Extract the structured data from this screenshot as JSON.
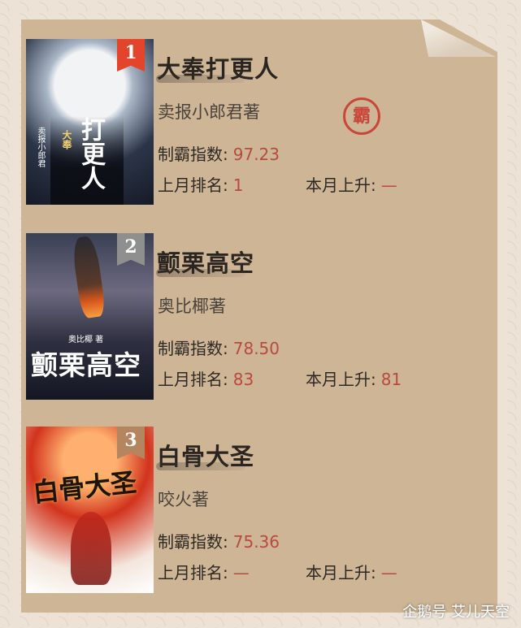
{
  "books": [
    {
      "rank": "1",
      "rank_color": "#e2442c",
      "title": "大奉打更人",
      "author": "卖报小郎君著",
      "index_label": "制霸指数:",
      "index_value": "97.23",
      "last_label": "上月排名:",
      "last_value": "1",
      "rise_label": "本月上升:",
      "rise_value": "—",
      "cover_title": "打更人",
      "cover_sub": "大奉",
      "cover_author": "卖报小郎君",
      "seal": "霸"
    },
    {
      "rank": "2",
      "rank_color": "#8f8f8f",
      "title": "颤栗高空",
      "author": "奥比椰著",
      "index_label": "制霸指数:",
      "index_value": "78.50",
      "last_label": "上月排名:",
      "last_value": "83",
      "rise_label": "本月上升:",
      "rise_value": "81",
      "cover_title": "颤栗高空",
      "cover_author": "奥比椰 著"
    },
    {
      "rank": "3",
      "rank_color": "#b58560",
      "title": "白骨大圣",
      "author": "咬火著",
      "index_label": "制霸指数:",
      "index_value": "75.36",
      "last_label": "上月排名:",
      "last_value": "—",
      "rise_label": "本月上升:",
      "rise_value": "—",
      "cover_title": "白骨大圣"
    }
  ],
  "watermark": "企鹅号 艾儿天空"
}
